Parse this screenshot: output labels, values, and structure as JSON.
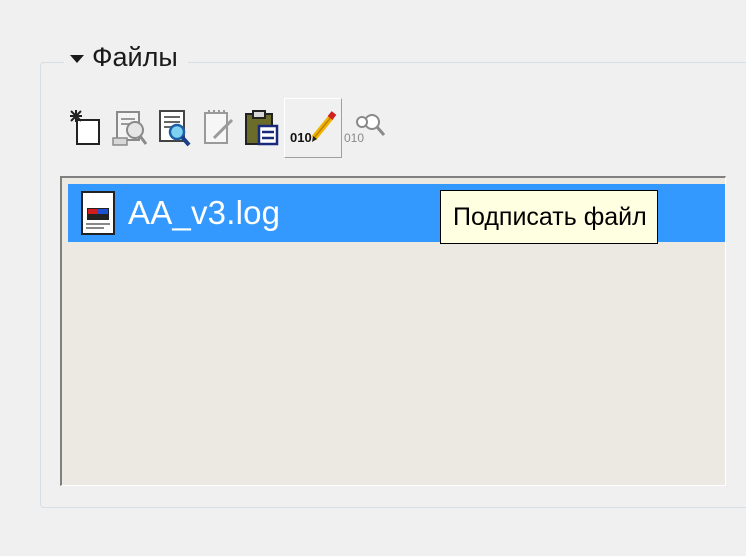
{
  "group": {
    "title": "Файлы",
    "expanded": true
  },
  "toolbar": {
    "buttons": [
      {
        "icon": "new-file-icon"
      },
      {
        "icon": "open-file-icon"
      },
      {
        "icon": "view-file-icon"
      },
      {
        "icon": "edit-file-icon"
      },
      {
        "icon": "paste-icon"
      },
      {
        "icon": "sign-file-icon"
      },
      {
        "icon": "verify-signature-icon"
      }
    ]
  },
  "files": [
    {
      "name": "AA_v3.log",
      "selected": true,
      "icon": "log-file-icon"
    }
  ],
  "tooltip": {
    "text": "Подписать файл"
  },
  "colors": {
    "selection": "#3399ff",
    "list_background": "#ece9e3",
    "tooltip_background": "#ffffe1"
  }
}
